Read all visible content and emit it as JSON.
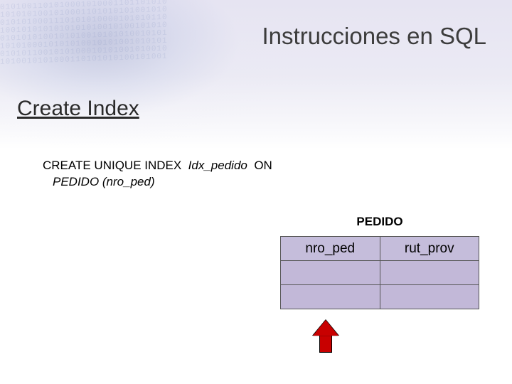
{
  "slide": {
    "title": "Instrucciones en SQL",
    "section": "Create Index"
  },
  "code": {
    "kw1": "CREATE UNIQUE INDEX",
    "idx_name": "Idx_pedido",
    "kw2": "ON",
    "line2": "PEDIDO (nro_ped)"
  },
  "table": {
    "title": "PEDIDO",
    "headers": [
      "nro_ped",
      "rut_prov"
    ],
    "rows": [
      [
        "",
        ""
      ],
      [
        "",
        ""
      ]
    ]
  },
  "bg_digits": "0101001101010001010001101101010\n1010101001010001101010101001010\n0101010001110101010000101010110\n1001010101010101010010100101010\n0101010100101010010101010010101\n1010100010101010010101001010101\n0101011001010100010101001010010\n1010010101000110101010100101001"
}
